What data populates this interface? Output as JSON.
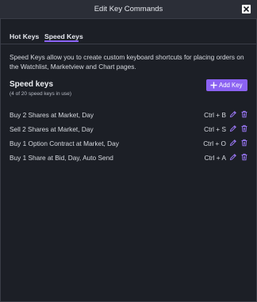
{
  "window": {
    "title": "Edit Key Commands"
  },
  "tabs": [
    {
      "label": "Hot Keys"
    },
    {
      "label": "Speed Keys"
    }
  ],
  "description": "Speed Keys allow you to create custom keyboard shortcuts for placing orders on the Watchlist, Marketview and Chart pages.",
  "speed_keys": {
    "title": "Speed keys",
    "usage": "(4 of 20 speed keys in use)",
    "add_label": "Add Key",
    "items": [
      {
        "name": "Buy 2 Shares at Market, Day",
        "shortcut": "Ctrl + B"
      },
      {
        "name": "Sell 2 Shares at Market, Day",
        "shortcut": "Ctrl + S"
      },
      {
        "name": "Buy 1 Option Contract at Market, Day",
        "shortcut": "Ctrl + O"
      },
      {
        "name": "Buy 1 Share at Bid, Day, Auto Send",
        "shortcut": "Ctrl + A"
      }
    ]
  },
  "colors": {
    "accent": "#8b62f2",
    "background": "#1c1f26",
    "titlebar": "#2b2e37"
  },
  "icons": {
    "close": "close-icon",
    "add": "plus-icon",
    "edit": "pencil-icon",
    "delete": "trash-icon"
  }
}
